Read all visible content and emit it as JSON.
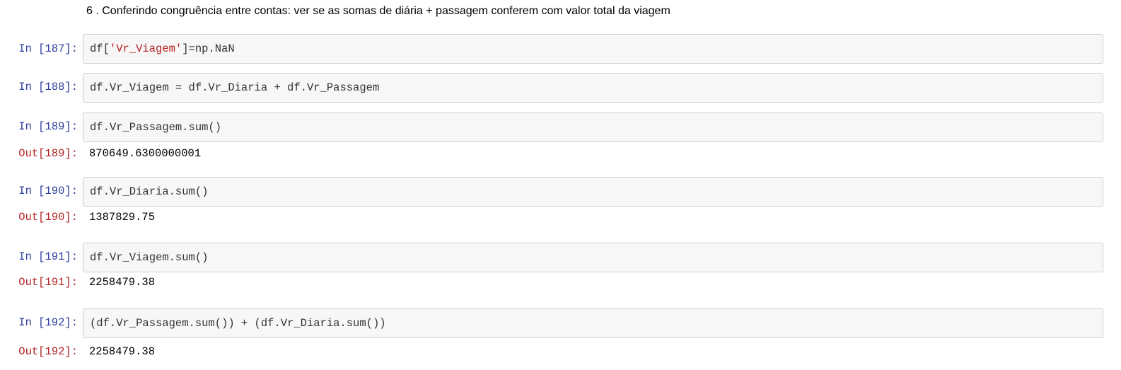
{
  "heading": "6 . Conferindo congruência entre contas: ver se as somas de diária + passagem conferem com valor total da viagem",
  "cells": [
    {
      "in_prompt": "In [187]:",
      "code_pre": "df[",
      "code_str": "'Vr_Viagem'",
      "code_post": "]=np.NaN"
    },
    {
      "in_prompt": "In [188]:",
      "code": "df.Vr_Viagem = df.Vr_Diaria + df.Vr_Passagem"
    },
    {
      "in_prompt": "In [189]:",
      "code": "df.Vr_Passagem.sum()",
      "out_prompt": "Out[189]:",
      "output": "870649.6300000001"
    },
    {
      "in_prompt": "In [190]:",
      "code": "df.Vr_Diaria.sum()",
      "out_prompt": "Out[190]:",
      "output": "1387829.75"
    },
    {
      "in_prompt": "In [191]:",
      "code": "df.Vr_Viagem.sum()",
      "out_prompt": "Out[191]:",
      "output": "2258479.38"
    },
    {
      "in_prompt": "In [192]:",
      "code": "(df.Vr_Passagem.sum()) + (df.Vr_Diaria.sum())",
      "out_prompt": "Out[192]:",
      "output": "2258479.38"
    }
  ],
  "colors": {
    "in_prompt": "#303F9F",
    "out_prompt": "#B22222",
    "string": "#BA2121",
    "cell_bg": "#f7f7f7"
  }
}
